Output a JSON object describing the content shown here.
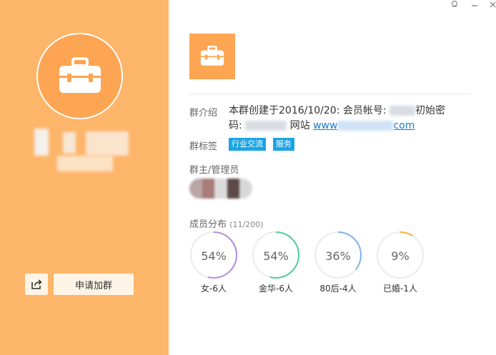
{
  "colors": {
    "left_panel": "#fdb56a",
    "accent": "#fda552",
    "tag_bg": "#1aa4e6",
    "link": "#1e78c8"
  },
  "left": {
    "avatar_icon": "briefcase-icon",
    "share_icon": "share-icon",
    "join_label": "申请加群"
  },
  "header": {
    "group_icon": "briefcase-icon",
    "window_controls": [
      "skin-icon",
      "minimize-icon",
      "close-icon"
    ]
  },
  "info": {
    "intro_label": "群介绍",
    "intro_text_1": "本群创建于2016/10/20: 会员帐号: ",
    "intro_text_2": "初始密",
    "intro_text_3": "码: ",
    "intro_text_4": " 网站 ",
    "intro_link_start": "www",
    "intro_link_end": "com",
    "tags_label": "群标签",
    "tags": [
      "行业交流",
      "服务"
    ],
    "admins_label": "群主/管理员"
  },
  "members": {
    "title": "成员分布",
    "count": "(11/200)",
    "stats": [
      {
        "percent_text": "54%",
        "value": 0.54,
        "color": "#b38be0",
        "label": "女-6人"
      },
      {
        "percent_text": "54%",
        "value": 0.54,
        "color": "#4fcf94",
        "label": "金华-6人"
      },
      {
        "percent_text": "36%",
        "value": 0.36,
        "color": "#7fb4ee",
        "label": "80后-4人"
      },
      {
        "percent_text": "9%",
        "value": 0.09,
        "color": "#f7b43a",
        "label": "已婚-1人"
      }
    ]
  }
}
